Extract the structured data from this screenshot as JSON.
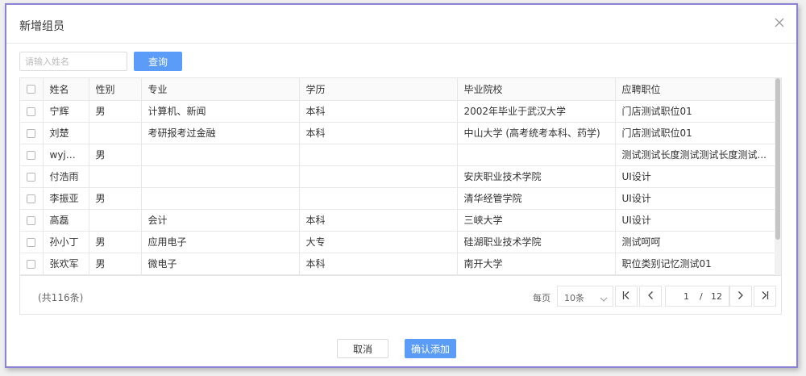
{
  "dialog": {
    "title": "新增组员"
  },
  "search": {
    "placeholder": "请输入姓名",
    "value": "",
    "button_label": "查询"
  },
  "table": {
    "columns": [
      "姓名",
      "性别",
      "专业",
      "学历",
      "毕业院校",
      "应聘职位"
    ],
    "rows": [
      [
        "宁辉",
        "男",
        "计算机、新闻",
        "本科",
        "2002年毕业于武汉大学",
        "门店测试职位01"
      ],
      [
        "刘楚",
        "",
        "考研报考过金融",
        "本科",
        "中山大学 (高考统考本科、药学)",
        "门店测试职位01"
      ],
      [
        "wyj内...",
        "男",
        "",
        "",
        "",
        "测试测试长度测试测试长度测试..."
      ],
      [
        "付浩雨",
        "",
        "",
        "",
        "安庆职业技术学院",
        "UI设计"
      ],
      [
        "李振亚",
        "男",
        "",
        "",
        "清华经管学院",
        "UI设计"
      ],
      [
        "高磊",
        "",
        "会计",
        "本科",
        "三峡大学",
        "UI设计"
      ],
      [
        "孙小丁",
        "男",
        "应用电子",
        "大专",
        "硅湖职业技术学院",
        "测试呵呵"
      ],
      [
        "张欢军",
        "男",
        "微电子",
        "本科",
        "南开大学",
        "职位类别记忆测试01"
      ]
    ]
  },
  "pagination": {
    "total_text": "(共116条)",
    "per_page_label": "每页",
    "per_page_value": "10条",
    "current_page": "1",
    "separator": "/",
    "total_pages": "12"
  },
  "actions": {
    "cancel_label": "取消",
    "confirm_label": "确认添加"
  },
  "colors": {
    "primary": "#5a9cf8",
    "border_accent": "#8a83d4"
  }
}
